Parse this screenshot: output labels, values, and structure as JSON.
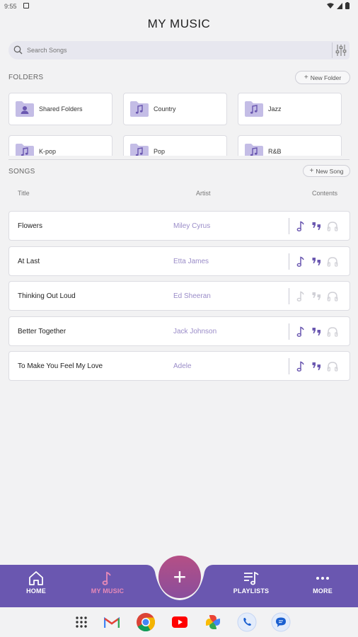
{
  "status": {
    "time": "9:55"
  },
  "header": {
    "title": "MY MUSIC"
  },
  "search": {
    "placeholder": "Search Songs",
    "value": ""
  },
  "folders": {
    "label": "FOLDERS",
    "new_button": "New Folder",
    "items": [
      {
        "name": "Shared Folders",
        "icon": "person-folder-icon"
      },
      {
        "name": "Country",
        "icon": "music-folder-icon"
      },
      {
        "name": "Jazz",
        "icon": "music-folder-icon"
      },
      {
        "name": "K-pop",
        "icon": "music-folder-icon"
      },
      {
        "name": "Pop",
        "icon": "music-folder-icon"
      },
      {
        "name": "R&B",
        "icon": "music-folder-icon"
      }
    ]
  },
  "songs": {
    "label": "SONGS",
    "new_button": "New Song",
    "columns": {
      "title": "Title",
      "artist": "Artist",
      "contents": "Contents"
    },
    "rows": [
      {
        "title": "Flowers",
        "artist": "Miley Cyrus",
        "has_notes": true,
        "has_lyrics": true,
        "has_audio": false
      },
      {
        "title": "At Last",
        "artist": "Etta James",
        "has_notes": true,
        "has_lyrics": true,
        "has_audio": false
      },
      {
        "title": "Thinking Out Loud",
        "artist": "Ed Sheeran",
        "has_notes": false,
        "has_lyrics": false,
        "has_audio": false
      },
      {
        "title": "Better Together",
        "artist": "Jack Johnson",
        "has_notes": true,
        "has_lyrics": true,
        "has_audio": false
      },
      {
        "title": "To Make You Feel My Love",
        "artist": "Adele",
        "has_notes": true,
        "has_lyrics": true,
        "has_audio": false
      }
    ]
  },
  "nav": {
    "home": "HOME",
    "my_music": "MY MUSIC",
    "playlists": "PLAYLISTS",
    "more": "MORE",
    "fab": "+"
  },
  "colors": {
    "accent": "#6750a4",
    "nav_bg": "#6a57b0",
    "active_nav": "#e88ab8",
    "artist_text": "#9a8cc8",
    "icon_active": "#6a57b0",
    "icon_inactive": "#d0d0d6"
  }
}
